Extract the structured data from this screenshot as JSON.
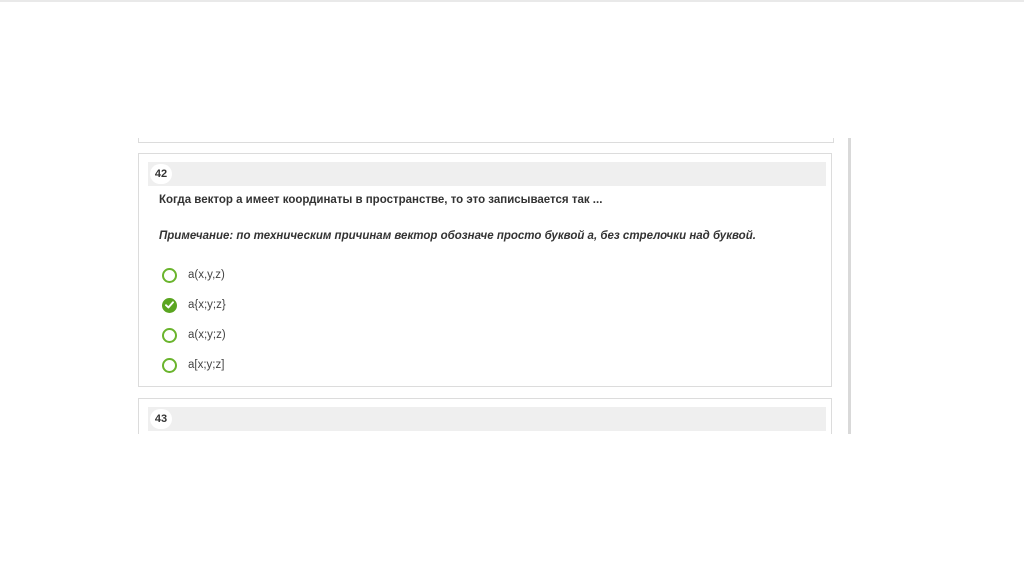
{
  "quiz": {
    "questions": [
      {
        "number": "42",
        "text": "Когда вектор а имеет координаты в пространстве, то это записывается так ...",
        "note": "Примечание: по техническим причинам вектор обозначе просто буквой а, без стрелочки над буквой.",
        "options": [
          {
            "label": "a(x,y,z)",
            "selected": false
          },
          {
            "label": "a{x;y;z}",
            "selected": true
          },
          {
            "label": "a(x;y;z)",
            "selected": false
          },
          {
            "label": "a[x;y;z]",
            "selected": false
          }
        ]
      },
      {
        "number": "43"
      }
    ]
  },
  "colors": {
    "radio_accent": "#6ab42d",
    "selected_fill": "#5aa520",
    "number_bar": "#efefef"
  },
  "icons": {
    "unselected": "radio-unchecked-icon",
    "selected": "check-circle-icon"
  }
}
